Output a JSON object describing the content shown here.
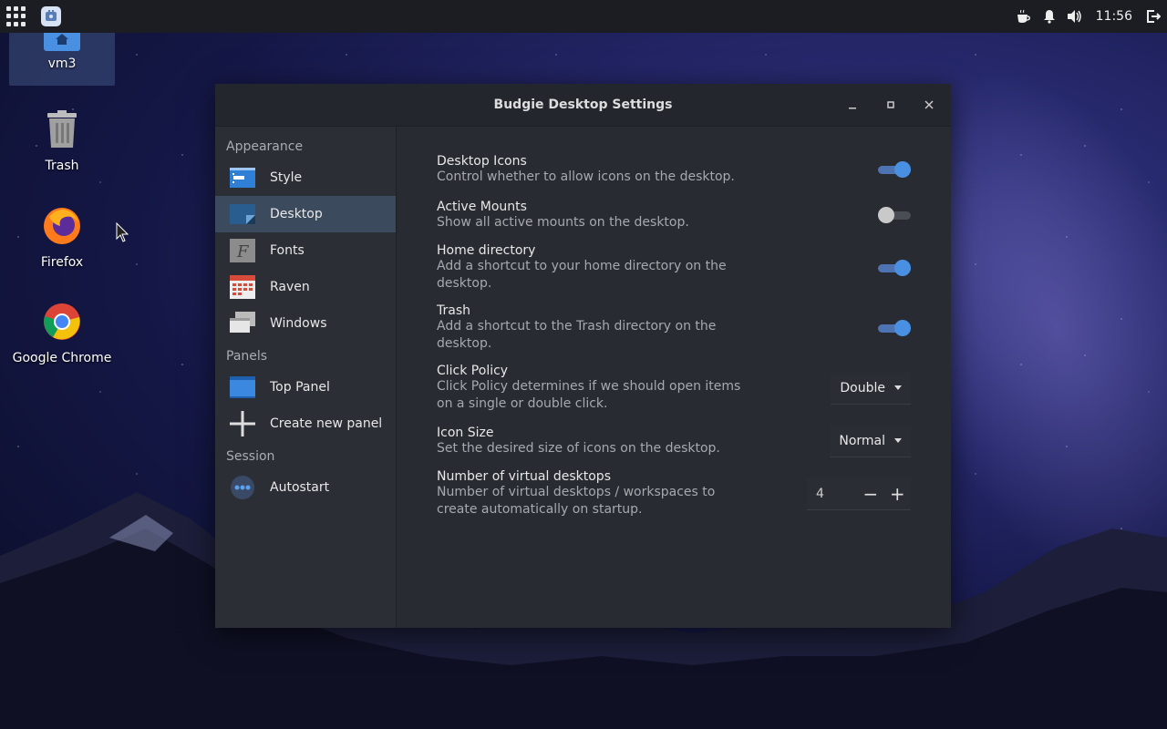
{
  "topbar": {
    "clock": "11:56"
  },
  "desktop": {
    "icons": [
      {
        "label": "vm3"
      },
      {
        "label": "Trash"
      },
      {
        "label": "Firefox"
      },
      {
        "label": "Google Chrome"
      }
    ]
  },
  "window": {
    "title": "Budgie Desktop Settings",
    "sidebar": {
      "section_appearance": "Appearance",
      "section_panels": "Panels",
      "section_session": "Session",
      "items": [
        {
          "label": "Style"
        },
        {
          "label": "Desktop"
        },
        {
          "label": "Fonts"
        },
        {
          "label": "Raven"
        },
        {
          "label": "Windows"
        },
        {
          "label": "Top Panel"
        },
        {
          "label": "Create new panel"
        },
        {
          "label": "Autostart"
        }
      ]
    },
    "settings": [
      {
        "name": "Desktop Icons",
        "desc": "Control whether to allow icons on the desktop.",
        "enabled": true
      },
      {
        "name": "Active Mounts",
        "desc": "Show all active mounts on the desktop.",
        "enabled": false
      },
      {
        "name": "Home directory",
        "desc": "Add a shortcut to your home directory on the desktop.",
        "enabled": true
      },
      {
        "name": "Trash",
        "desc": "Add a shortcut to the Trash directory on the desktop.",
        "enabled": true
      },
      {
        "name": "Click Policy",
        "desc": "Click Policy determines if we should open items on a single or double click.",
        "value": "Double"
      },
      {
        "name": "Icon Size",
        "desc": "Set the desired size of icons on the desktop.",
        "value": "Normal"
      },
      {
        "name": "Number of virtual desktops",
        "desc": "Number of virtual desktops / workspaces to create automatically on startup.",
        "value": "4"
      }
    ]
  },
  "colors": {
    "accent": "#4a90e2",
    "active_nav": "#3c4a5e"
  }
}
